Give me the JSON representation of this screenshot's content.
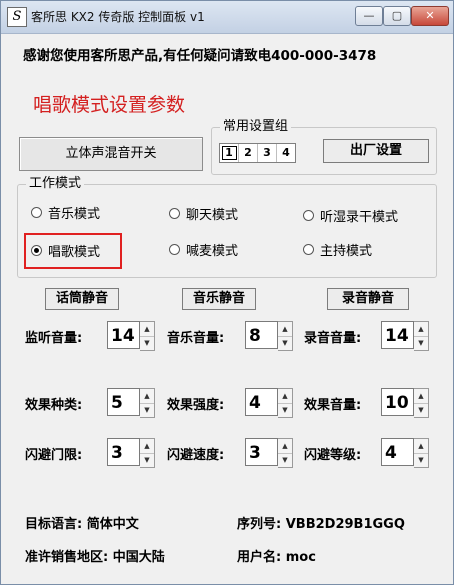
{
  "titlebar": {
    "icon_glyph": "S",
    "title": "客所思 KX2 传奇版  控制面板 v1",
    "min_glyph": "—",
    "max_glyph": "▢",
    "close_glyph": "✕"
  },
  "welcome": "感谢您使用客所思产品,有任何疑问请致电400-000-3478",
  "section_title": "唱歌模式设置参数",
  "stereo_button": "立体声混音开关",
  "common_group": {
    "label": "常用设置组",
    "tabs": [
      "1",
      "2",
      "3",
      "4"
    ],
    "factory_button": "出厂设置"
  },
  "mode_group": {
    "label": "工作模式",
    "options": [
      "音乐模式",
      "聊天模式",
      "听湿录干模式",
      "唱歌模式",
      "喊麦模式",
      "主持模式"
    ],
    "selected": "唱歌模式"
  },
  "mute_buttons": [
    "话筒静音",
    "音乐静音",
    "录音静音"
  ],
  "controls": {
    "monitor_volume": {
      "label": "监听音量:",
      "value": "14"
    },
    "music_volume": {
      "label": "音乐音量:",
      "value": "8"
    },
    "record_volume": {
      "label": "录音音量:",
      "value": "14"
    },
    "effect_type": {
      "label": "效果种类:",
      "value": "5"
    },
    "effect_strength": {
      "label": "效果强度:",
      "value": "4"
    },
    "effect_volume": {
      "label": "效果音量:",
      "value": "10"
    },
    "dodge_threshold": {
      "label": "闪避门限:",
      "value": "3"
    },
    "dodge_speed": {
      "label": "闪避速度:",
      "value": "3"
    },
    "dodge_level": {
      "label": "闪避等级:",
      "value": "4"
    }
  },
  "spin_glyphs": {
    "up": "▲",
    "down": "▼"
  },
  "info": {
    "target_language_label": "目标语言:",
    "target_language_value": "简体中文",
    "serial_label": "序列号:",
    "serial_value": "VBB2D29B1GGQ",
    "region_label": "准许销售地区:",
    "region_value": "中国大陆",
    "user_label": "用户名:",
    "user_value": "moc"
  }
}
